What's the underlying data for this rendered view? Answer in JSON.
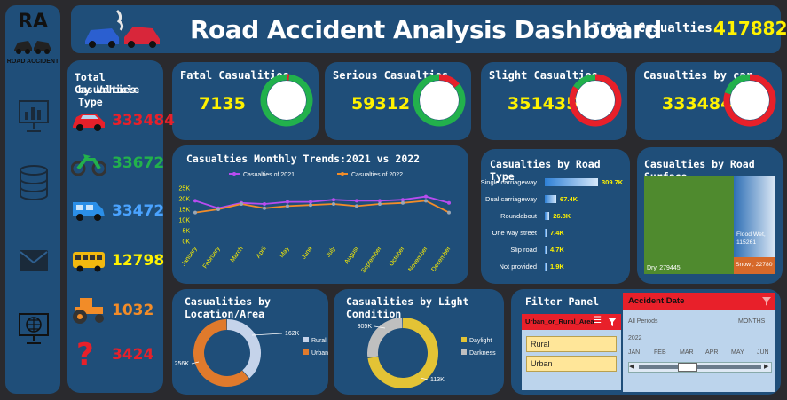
{
  "logo": {
    "text": "RA",
    "subtitle": "ROAD ACCIDENT"
  },
  "header": {
    "title": "Road Accident Analysis Dashboard",
    "total_label": "Total Casualties",
    "total_value": "417882"
  },
  "kpis": [
    {
      "title": "Fatal Casualities",
      "value": "7135",
      "pct": "1.7%",
      "fraction": 0.017
    },
    {
      "title": "Serious Casualties",
      "value": "59312",
      "pct": "14.2%",
      "fraction": 0.142
    },
    {
      "title": "Slight Casualties",
      "value": "351435",
      "pct": "84.1%",
      "fraction": 0.841
    },
    {
      "title": "Casualties by car",
      "value": "333484",
      "pct": "79.80%",
      "fraction": 0.798
    }
  ],
  "vehicles": {
    "title_line1": "Total Casualties",
    "title_line2": "by Vehicle Type",
    "items": [
      {
        "icon": "car-icon",
        "value": "333484",
        "color": "#e8202a"
      },
      {
        "icon": "motorcycle-icon",
        "value": "33672",
        "color": "#22b14c"
      },
      {
        "icon": "van-icon",
        "value": "33472",
        "color": "#4aa3ff"
      },
      {
        "icon": "bus-icon",
        "value": "12798",
        "color": "#fff200"
      },
      {
        "icon": "tractor-icon",
        "value": "1032",
        "color": "#f28c28"
      },
      {
        "icon": "question-icon",
        "value": "3424",
        "color": "#e8202a"
      }
    ]
  },
  "trend": {
    "title": "Casualties Monthly Trends:2021 vs 2022",
    "chart_data": {
      "type": "line",
      "categories": [
        "January",
        "February",
        "March",
        "April",
        "May",
        "June",
        "July",
        "August",
        "September",
        "October",
        "November",
        "December"
      ],
      "series": [
        {
          "name": "Casualties of 2021",
          "color": "#b84cf0",
          "values": [
            19000,
            15500,
            18000,
            17500,
            18500,
            18500,
            19500,
            19000,
            19000,
            19500,
            21000,
            18000
          ]
        },
        {
          "name": "Casualties of 2022",
          "color": "#f28c28",
          "values": [
            13500,
            15000,
            17500,
            15500,
            16500,
            17000,
            17500,
            16500,
            17500,
            18000,
            19000,
            13500
          ]
        }
      ],
      "yticks": [
        "0K",
        "5K",
        "10K",
        "15K",
        "20K",
        "25K"
      ],
      "ylim": [
        0,
        25000
      ]
    }
  },
  "road_type": {
    "title": "Casualties by Road Type",
    "chart_data": {
      "type": "bar",
      "categories": [
        "Single carriageway",
        "Dual carriageway",
        "Roundabout",
        "One way street",
        "Slip road",
        "Not provided"
      ],
      "values": [
        309700,
        67400,
        26800,
        7400,
        4700,
        1900
      ],
      "labels": [
        "309.7K",
        "67.4K",
        "26.8K",
        "7.4K",
        "4.7K",
        "1.9K"
      ]
    }
  },
  "road_surface": {
    "title": "Casualties by Road Surface",
    "chart_data": {
      "type": "treemap",
      "items": [
        {
          "label": "Dry, 279445",
          "value": 279445,
          "color": "#4f8a2e"
        },
        {
          "label": "Flood Wet, 115261",
          "value": 115261,
          "color": "#dce8f5"
        },
        {
          "label": "Snow , 22780",
          "value": 22780,
          "color": "#d6692a"
        }
      ]
    }
  },
  "location": {
    "title": "Casualities by Location/Area",
    "chart_data": {
      "type": "pie",
      "labels": [
        "Rural",
        "Urban"
      ],
      "values": [
        162,
        256
      ],
      "data_labels": [
        "162K",
        "256K"
      ],
      "colors": [
        "#c5d3ea",
        "#e07a2c"
      ]
    }
  },
  "light": {
    "title": "Casualities by Light Condition",
    "chart_data": {
      "type": "pie",
      "labels": [
        "Daylight",
        "Darkness"
      ],
      "values": [
        305,
        113
      ],
      "data_labels": [
        "305K",
        "113K"
      ],
      "colors": [
        "#e3c335",
        "#bfbfbf"
      ]
    }
  },
  "filter": {
    "title": "Filter Panel",
    "slicer_title": "Urban_or_Rural_Area",
    "options": [
      "Rural",
      "Urban"
    ],
    "timeline_title": "Accident Date",
    "period_label": "All Periods",
    "unit_label": "MONTHS",
    "year": "2022",
    "months": [
      "JAN",
      "FEB",
      "MAR",
      "APR",
      "MAY",
      "JUN"
    ]
  }
}
